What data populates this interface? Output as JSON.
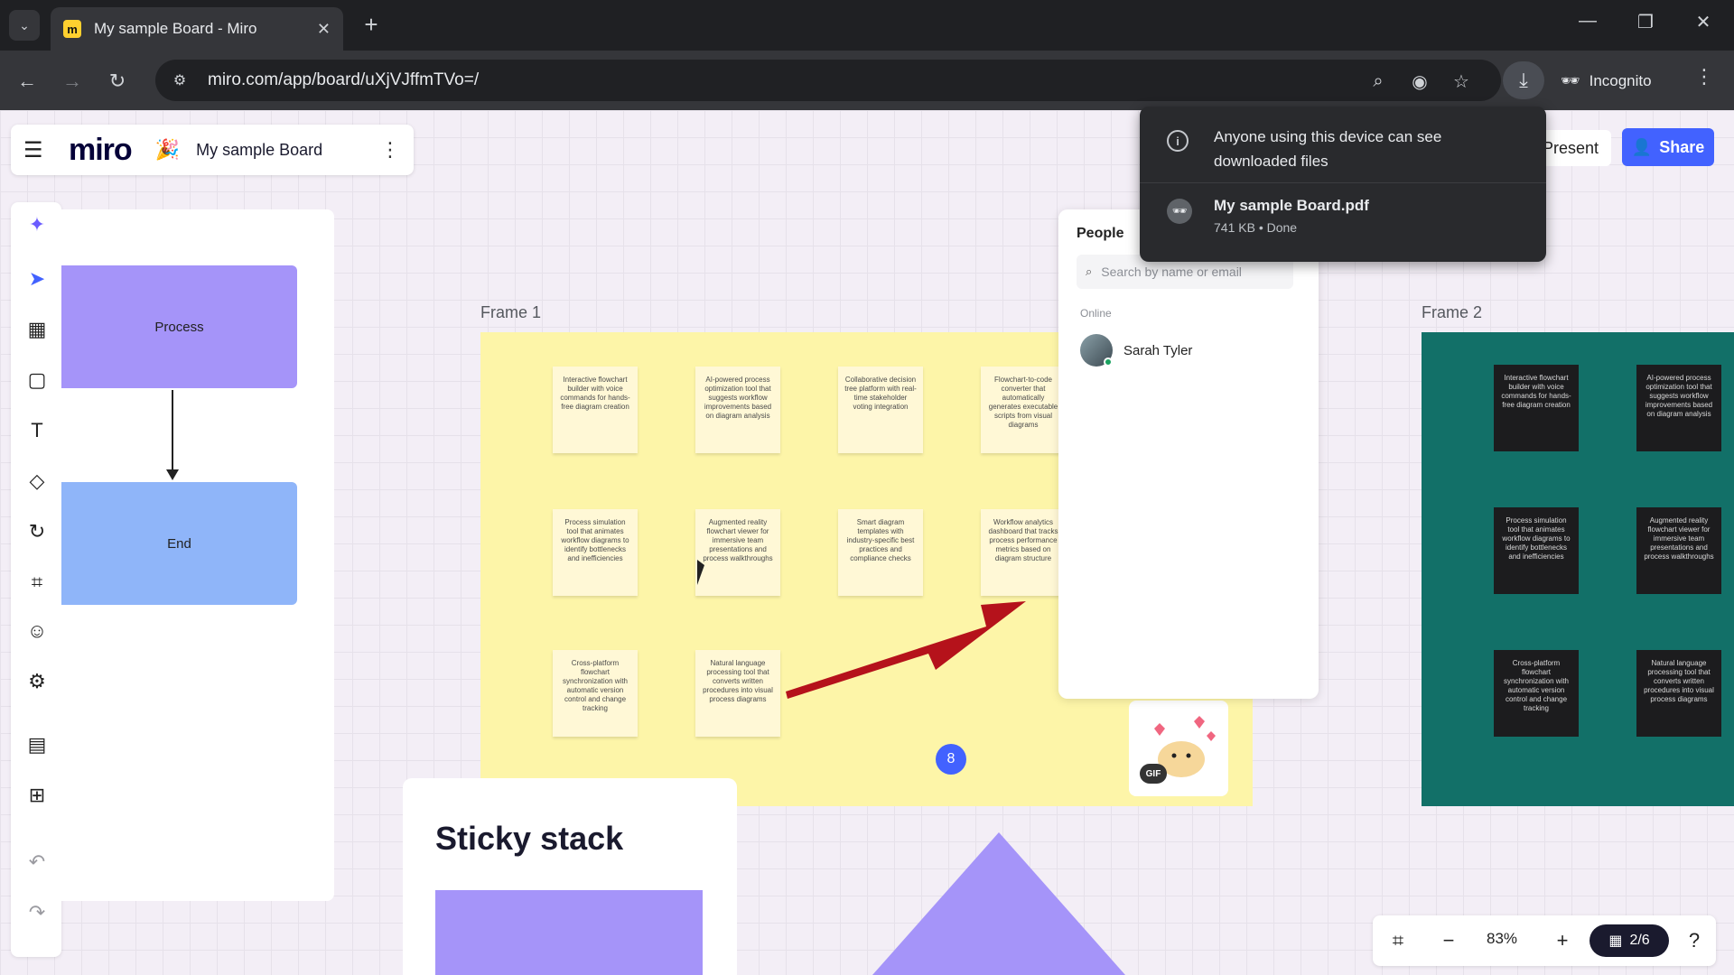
{
  "browser": {
    "tab_title": "My sample Board - Miro",
    "url": "miro.com/app/board/uXjVJffmTVo=/",
    "incognito_label": "Incognito",
    "favicon_letter": "m"
  },
  "header": {
    "logo": "miro",
    "board_name": "My sample Board",
    "present_label": "Present",
    "share_label": "Share"
  },
  "templates_panel": {
    "process_label": "Process",
    "end_label": "End"
  },
  "frames": {
    "frame1_label": "Frame 1",
    "frame2_label": "Frame 2",
    "frame1_stickies": [
      "Interactive flowchart builder with voice commands for hands-free diagram creation",
      "AI-powered process optimization tool that suggests workflow improvements based on diagram analysis",
      "Collaborative decision tree platform with real-time stakeholder voting integration",
      "Flowchart-to-code converter that automatically generates executable scripts from visual diagrams",
      "Process simulation tool that animates workflow diagrams to identify bottlenecks and inefficiencies",
      "Augmented reality flowchart viewer for immersive team presentations and process walkthroughs",
      "Smart diagram templates with industry-specific best practices and compliance checks",
      "Workflow analytics dashboard that tracks process performance metrics based on diagram structure",
      "Cross-platform flowchart synchronization with automatic version control and change tracking",
      "Natural language processing tool that converts written procedures into visual process diagrams"
    ],
    "frame2_stickies": [
      "Interactive flowchart builder with voice commands for hands-free diagram creation",
      "AI-powered process optimization tool that suggests workflow improvements based on diagram analysis",
      "Process simulation tool that animates workflow diagrams to identify bottlenecks and inefficiencies",
      "Augmented reality flowchart viewer for immersive team presentations and process walkthroughs",
      "Cross-platform flowchart synchronization with automatic version control and change tracking",
      "Natural language processing tool that converts written procedures into visual process diagrams"
    ]
  },
  "people_panel": {
    "title": "People",
    "search_placeholder": "Search by name or email",
    "online_label": "Online",
    "person_name": "Sarah Tyler"
  },
  "badges": {
    "count": "8",
    "gif": "GIF"
  },
  "sticky_stack": {
    "title": "Sticky stack"
  },
  "download": {
    "warning": "Anyone using this device can see downloaded files",
    "file_name": "My sample Board.pdf",
    "file_meta": "741 KB • Done"
  },
  "zoom": {
    "level": "83%",
    "pages": "2/6"
  },
  "colors": {
    "accent": "#4262ff",
    "process_fill": "#a594f9",
    "end_fill": "#8fb5f9",
    "frame1_bg": "#fdf5a8",
    "frame2_bg": "#127068",
    "arrow": "#b5121b"
  }
}
